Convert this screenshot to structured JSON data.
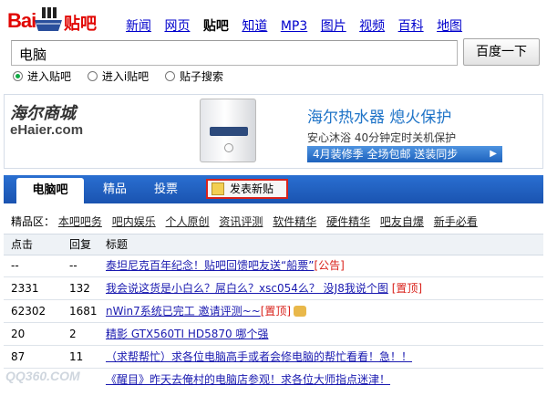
{
  "logo": {
    "bai": "Bai",
    "tieba": "贴吧"
  },
  "nav": [
    "新闻",
    "网页",
    "贴吧",
    "知道",
    "MP3",
    "图片",
    "视频",
    "百科",
    "地图"
  ],
  "search": {
    "value": "电脑",
    "button": "百度一下"
  },
  "radios": [
    {
      "label": "进入贴吧",
      "checked": true
    },
    {
      "label": "进入i贴吧",
      "checked": false
    },
    {
      "label": "贴子搜索",
      "checked": false
    }
  ],
  "banner": {
    "brand_cn": "海尔商城",
    "brand_en": "eHaier.com",
    "headline": "海尔热水器 熄火保护",
    "subline": "安心沐浴 40分钟定时关机保护",
    "bar": "4月装修季 全场包邮 送装同步"
  },
  "tabs": [
    "电脑吧",
    "精品",
    "投票"
  ],
  "post_button": "发表新贴",
  "jingpin": {
    "label": "精品区：",
    "links": [
      "本吧吧务",
      "吧内娱乐",
      "个人原创",
      "资讯评测",
      "软件精华",
      "硬件精华",
      "吧友自爆",
      "新手必看"
    ]
  },
  "table": {
    "headers": [
      "点击",
      "回复",
      "标题"
    ],
    "rows": [
      {
        "clicks": "--",
        "replies": "--",
        "title": "泰坦尼克百年纪念！贴吧回馈吧友送“船票”",
        "tag": "[公告]"
      },
      {
        "clicks": "2331",
        "replies": "132",
        "title": "我会说这货是小白么？屌白么？xsc054么？ 没J8我说个图",
        "tag": "[置顶]"
      },
      {
        "clicks": "62302",
        "replies": "1681",
        "title": "nWin7系统已完工 邀请评测~~",
        "tag": "[置顶]"
      },
      {
        "clicks": "20",
        "replies": "2",
        "title": "精影 GTX560TI HD5870 哪个强",
        "tag": ""
      },
      {
        "clicks": "87",
        "replies": "11",
        "title": "（求帮帮忙）求各位电脑高手或者会修电脑的帮忙看看！急！！",
        "tag": ""
      },
      {
        "clicks": "",
        "replies": "",
        "title": "《醒目》昨天去俺村的电脑店参观！求各位大师指点迷津！",
        "tag": ""
      }
    ]
  },
  "watermark": "QQ360.COM"
}
